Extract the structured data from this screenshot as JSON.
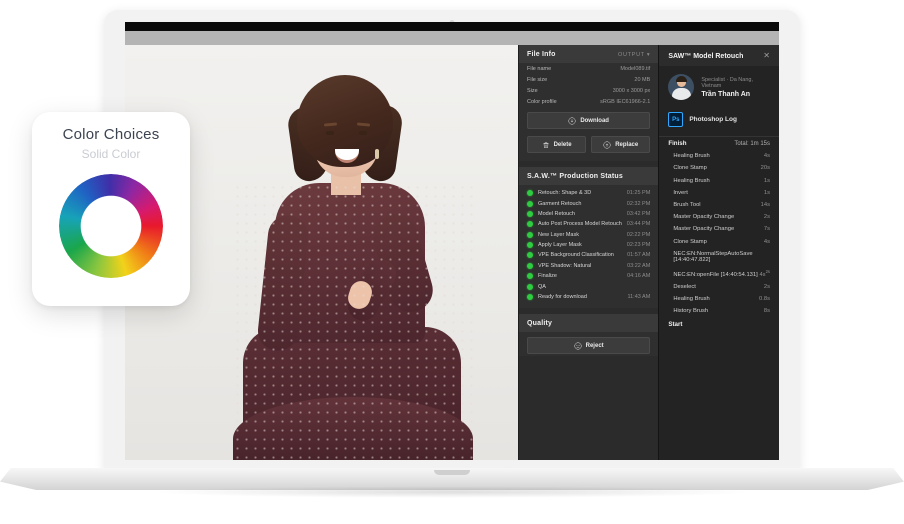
{
  "color_card": {
    "title": "Color Choices",
    "subtitle": "Solid Color",
    "wheel_icon": "color-wheel-icon"
  },
  "file_info": {
    "title": "File Info",
    "dropdown_label": "OUTPUT",
    "dropdown_caret": "▾",
    "fields": [
      {
        "key": "File name",
        "value": "Model089.tif"
      },
      {
        "key": "File size",
        "value": "20 MB"
      },
      {
        "key": "Size",
        "value": "3000 x 3000 px"
      },
      {
        "key": "Color profile",
        "value": "sRGB IEC61966-2.1"
      }
    ],
    "download_label": "Download",
    "delete_label": "Delete",
    "replace_label": "Replace"
  },
  "production": {
    "title": "S.A.W.™ Production Status",
    "items": [
      {
        "label": "Retouch: Shape & 3D",
        "time": "01:25 PM"
      },
      {
        "label": "Garment Retouch",
        "time": "02:32 PM"
      },
      {
        "label": "Model Retouch",
        "time": "03:42 PM"
      },
      {
        "label": "Auto Post Process Model Retouch",
        "time": "03:44 PM"
      },
      {
        "label": "New Layer Mask",
        "time": "02:22 PM"
      },
      {
        "label": "Apply Layer Mask",
        "time": "02:23 PM"
      },
      {
        "label": "VPE Background Classification",
        "time": "01:57 AM"
      },
      {
        "label": "VPE Shadow: Natural",
        "time": "03:22 AM"
      },
      {
        "label": "Finalize",
        "time": "04:16 AM"
      },
      {
        "label": "QA",
        "time": ""
      },
      {
        "label": "Ready for download",
        "time": "11:43 AM"
      }
    ]
  },
  "quality": {
    "title": "Quality",
    "reject_label": "Reject"
  },
  "retouch_panel": {
    "title": "SAW™ Model Retouch",
    "close_label": "✕",
    "specialist_role": "Specialist · Da Nang, Vietnam",
    "specialist_name": "Trần Thanh An",
    "ps_badge": "Ps",
    "ps_log_label": "Photoshop Log",
    "finish_label": "Finish",
    "total_label": "Total: 1m 15s",
    "start_label": "Start",
    "entries": [
      {
        "name": "NEC:EN:NormalStepAutoSave [14:40:47.822]",
        "duration": ""
      },
      {
        "name": "Healing Brush",
        "duration": "4s"
      },
      {
        "name": "Clone Stamp",
        "duration": "20s"
      },
      {
        "name": "Healing Brush",
        "duration": "1s"
      },
      {
        "name": "Invert",
        "duration": "1s"
      },
      {
        "name": "Brush Tool",
        "duration": "14s"
      },
      {
        "name": "Master Opacity Change",
        "duration": "2s"
      },
      {
        "name": "Master Opacity Change",
        "duration": "7s"
      },
      {
        "name": "Clone Stamp",
        "duration": "4s"
      },
      {
        "name": "Deselect",
        "duration": "2s"
      },
      {
        "name": "Healing Brush",
        "duration": "0.8s"
      },
      {
        "name": "History Brush",
        "duration": "8s"
      },
      {
        "name": "NEC:EN:openFile [14:40:54.131]",
        "duration": "4s",
        "sup": "2s"
      }
    ]
  },
  "colors": {
    "panel_bg": "#2b2b2b",
    "panel_alt_bg": "#232323",
    "status_dot": "#2ecc40",
    "ps_blue": "#31a8ff",
    "title_text": "#3c4350"
  }
}
